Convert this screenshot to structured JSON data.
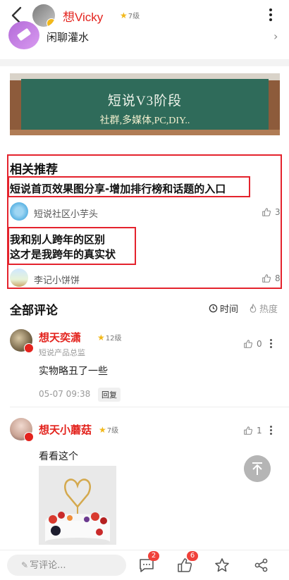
{
  "header": {
    "user_name": "想Vicky",
    "level": "7级"
  },
  "circle": {
    "name": "闲聊灌水"
  },
  "banner": {
    "title": "短说V3阶段",
    "subtitle": "社群,多媒体,PC,DIY.."
  },
  "related": {
    "title": "相关推荐",
    "items": [
      {
        "title_lines": [
          "短说首页效果图分享-增加排行榜和话题的入口"
        ],
        "author": "短说社区小芋头",
        "likes": "3"
      },
      {
        "title_lines": [
          "我和别人跨年的区别",
          "这才是我跨年的真实状"
        ],
        "author": "李记小饼饼",
        "likes": "8"
      }
    ]
  },
  "comments_section": {
    "title": "全部评论",
    "sort_time": "时间",
    "sort_hot": "热度"
  },
  "comments": [
    {
      "name": "想天奕潇",
      "level": "12级",
      "subtitle": "短说产品总监",
      "likes": "0",
      "text": "实物略丑了一些",
      "time": "05-07 09:38",
      "reply_label": "回复"
    },
    {
      "name": "想天小蘑菇",
      "level": "7级",
      "likes": "1",
      "text": "看看这个"
    }
  ],
  "bottom_bar": {
    "comment_placeholder": "写评论...",
    "comment_badge": "2",
    "like_badge": "6"
  },
  "colors": {
    "accent_red": "#e3231d",
    "highlight_border": "#e4232d"
  }
}
